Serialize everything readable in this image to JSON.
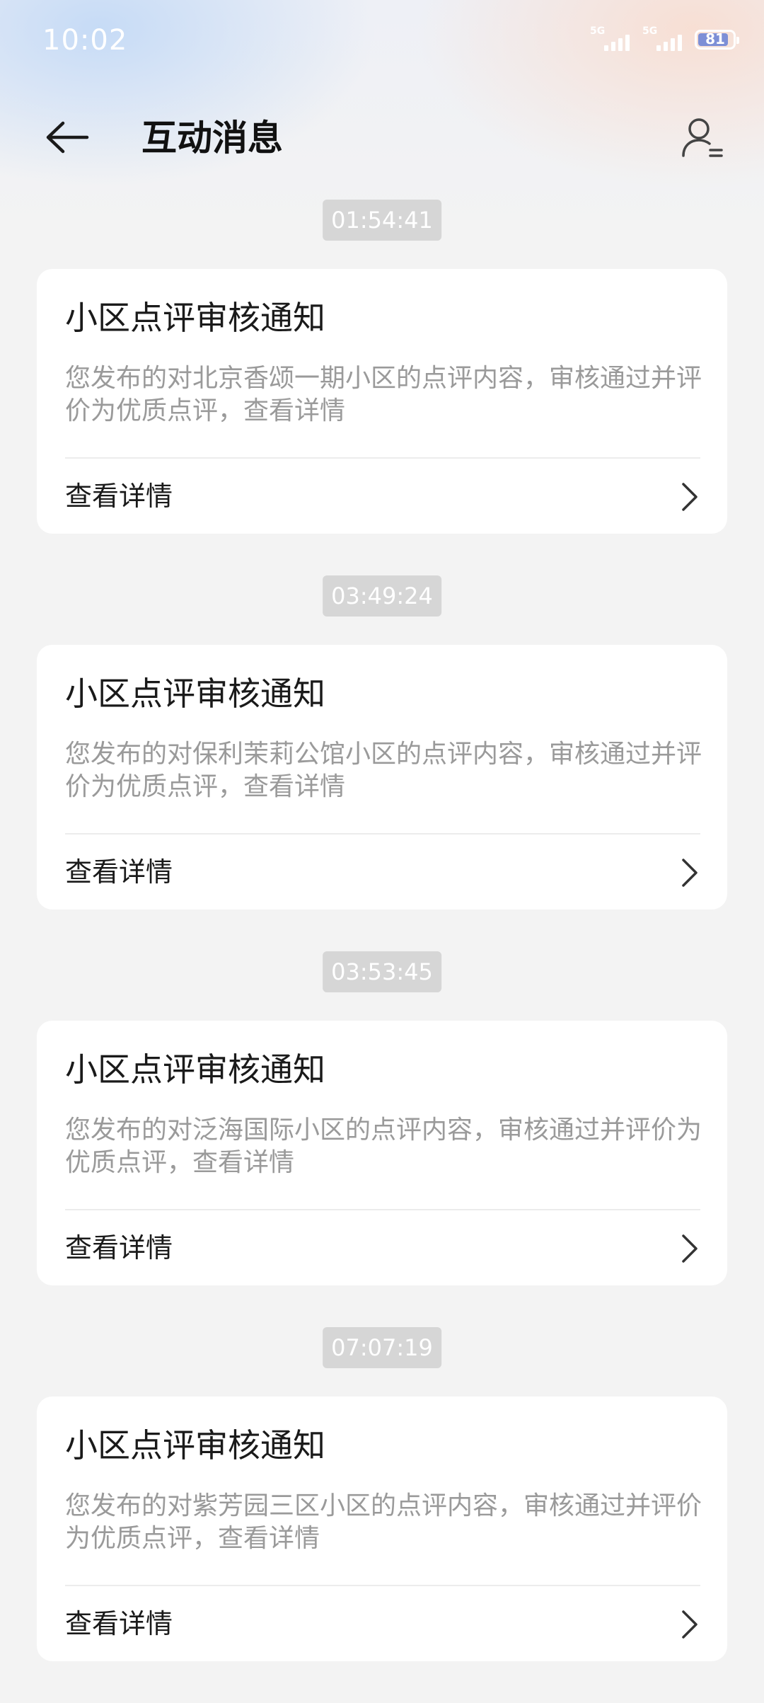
{
  "status_bar": {
    "time": "10:02",
    "network_1": "5G",
    "network_2": "5G",
    "battery_level": "81"
  },
  "header": {
    "title": "互动消息",
    "back_icon": "arrow-left-icon",
    "profile_icon": "user-list-icon"
  },
  "messages": [
    {
      "time": "01:54:41",
      "title": "小区点评审核通知",
      "description": "您发布的对北京香颂一期小区的点评内容，审核通过并评价为优质点评，查看详情",
      "action_label": "查看详情"
    },
    {
      "time": "03:49:24",
      "title": "小区点评审核通知",
      "description": "您发布的对保利茉莉公馆小区的点评内容，审核通过并评价为优质点评，查看详情",
      "action_label": "查看详情"
    },
    {
      "time": "03:53:45",
      "title": "小区点评审核通知",
      "description": "您发布的对泛海国际小区的点评内容，审核通过并评价为优质点评，查看详情",
      "action_label": "查看详情"
    },
    {
      "time": "07:07:19",
      "title": "小区点评审核通知",
      "description": "您发布的对紫芳园三区小区的点评内容，审核通过并评价为优质点评，查看详情",
      "action_label": "查看详情"
    }
  ],
  "colors": {
    "background": "#f3f3f3",
    "card": "#ffffff",
    "timestamp_bg": "#d6d6d6",
    "secondary_text": "#9a9a9a",
    "battery_fill": "#7d8fd6"
  }
}
